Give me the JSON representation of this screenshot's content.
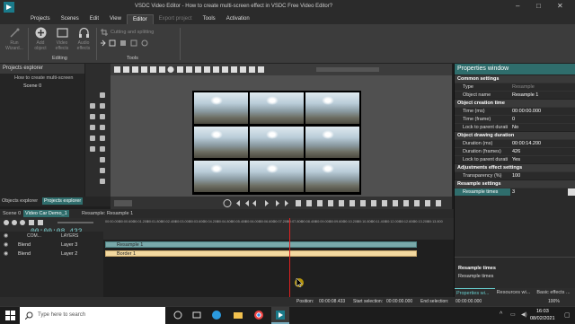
{
  "window": {
    "title": "VSDC Video Editor - How to create multi-screen effect in VSDC Free Video Editor?"
  },
  "menu": [
    {
      "label": "Projects"
    },
    {
      "label": "Scenes"
    },
    {
      "label": "Edit"
    },
    {
      "label": "View"
    },
    {
      "label": "Editor",
      "active": true
    },
    {
      "label": "Export project",
      "dim": true
    },
    {
      "label": "Tools"
    },
    {
      "label": "Activation"
    }
  ],
  "ribbon": {
    "run_wizard": "Run Wizard...",
    "add_object": "Add object",
    "video_effects": "Video effects",
    "audio_effects": "Audio effects",
    "cutting": "Cutting and splitting",
    "editing_group": "Editing",
    "tools_group": "Tools"
  },
  "project_explorer": {
    "title": "Projects explorer",
    "project": "How to create multi-screen",
    "scene": "Scene 0",
    "tabs": [
      "Objects explorer",
      "Projects explorer"
    ]
  },
  "properties": {
    "title": "Properties window",
    "common_settings": "Common settings",
    "type_label": "Type",
    "type_value": "Resample",
    "name_label": "Object name",
    "name_value": "Resample 1",
    "creation_time": "Object creation time",
    "time_ms_label": "Time (ms)",
    "time_ms_value": "00:00:00.000",
    "time_frame_label": "Time (frame)",
    "time_frame_value": "0",
    "lock_label": "Lock to parent durati",
    "lock_creation_value": "No",
    "drawing_duration": "Object drawing duration",
    "dur_ms_label": "Duration (ms)",
    "dur_ms_value": "00:00:14.200",
    "dur_frames_label": "Duration (frames)",
    "dur_frames_value": "426",
    "lock_duration_value": "Yes",
    "adjustments": "Adjustments effect settings",
    "transparency_label": "Transparency (%)",
    "transparency_value": "100",
    "resample_settings": "Resample settings",
    "resample_times_label": "Resample times",
    "resample_times_value": "3",
    "help_title": "Resample times",
    "help_text": "Resample times",
    "bottom_tabs": [
      "Properties wi...",
      "Resources wi...",
      "Basic effects ..."
    ]
  },
  "timeline": {
    "tabs": [
      "Scene 0",
      "Video Car Demo_1",
      "Resample: Resample 1"
    ],
    "current_time": "00:00:08.433",
    "com_label": "COM...",
    "layers_label": "LAYERS",
    "ruler": [
      "00:00.000",
      "00:00.600",
      "00:01.200",
      "00:01.800",
      "00:02.400",
      "00:03.000",
      "00:03.600",
      "00:04.200",
      "00:04.800",
      "00:05.400",
      "00:06.000",
      "00:06.600",
      "00:07.200",
      "00:07.800",
      "00:08.400",
      "00:09.000",
      "00:09.600",
      "00:10.200",
      "00:10.800",
      "00:11.400",
      "00:12.000",
      "00:12.600",
      "00:13.200",
      "00:13.800"
    ],
    "tracks": [
      {
        "blend": "Blend",
        "layer": "Layer 3",
        "clip": "Resample 1"
      },
      {
        "blend": "Blend",
        "layer": "Layer 2",
        "clip": "Border 1"
      }
    ]
  },
  "status": {
    "position_label": "Position:",
    "position_value": "00:00:08.433",
    "start_label": "Start selection:",
    "start_value": "00:00:00.000",
    "end_label": "End selection:",
    "end_value": "00:00:00.000",
    "zoom": "100%"
  },
  "taskbar": {
    "search_placeholder": "Type here to search",
    "time": "16:03",
    "date": "08/02/2021"
  },
  "colors": {
    "accent": "#2f6d6c",
    "clip_resample": "#79a9aa",
    "clip_border": "#f3d9a0",
    "playhead": "#e02020"
  }
}
